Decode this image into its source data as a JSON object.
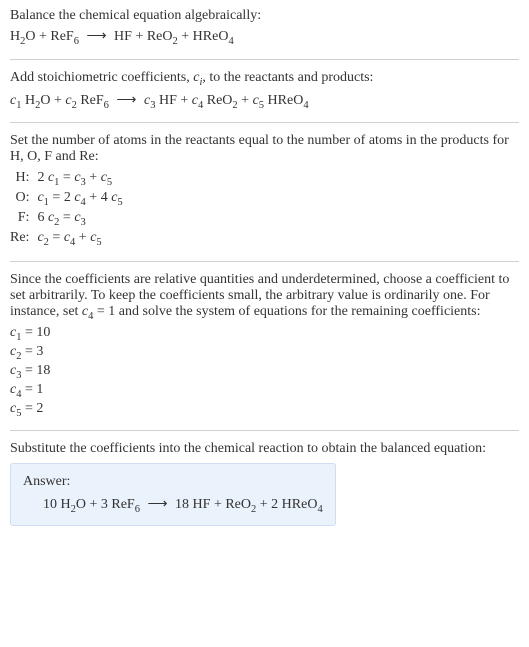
{
  "section1": {
    "title": "Balance the chemical equation algebraically:",
    "equation_parts": {
      "r1": "H",
      "r1_sub": "2",
      "r1_tail": "O + ReF",
      "r1_sub2": "6",
      "arrow": " ⟶ ",
      "p1": "HF + ReO",
      "p1_sub": "2",
      "p1_tail": " + HReO",
      "p1_sub2": "4"
    }
  },
  "section2": {
    "intro_a": "Add stoichiometric coefficients, ",
    "ci": "c",
    "ci_sub": "i",
    "intro_b": ", to the reactants and products:",
    "eq": {
      "c1": "c",
      "c1_sub": "1",
      "sp1": " H",
      "sp1_sub": "2",
      "sp1_tail": "O + ",
      "c2": "c",
      "c2_sub": "2",
      "sp2": " ReF",
      "sp2_sub": "6",
      "arrow": " ⟶ ",
      "c3": "c",
      "c3_sub": "3",
      "sp3": " HF + ",
      "c4": "c",
      "c4_sub": "4",
      "sp4": " ReO",
      "sp4_sub": "2",
      "sp4_tail": " + ",
      "c5": "c",
      "c5_sub": "5",
      "sp5": " HReO",
      "sp5_sub": "4"
    }
  },
  "section3": {
    "intro": "Set the number of atoms in the reactants equal to the number of atoms in the products for H, O, F and Re:",
    "rows": [
      {
        "elem": "H:",
        "lhs_a": "2 ",
        "lhs_c": "c",
        "lhs_sub": "1",
        "eq": " = ",
        "rhs_c1": "c",
        "rhs_sub1": "3",
        "plus": " + ",
        "rhs_c2": "c",
        "rhs_sub2": "5"
      },
      {
        "elem": "O:",
        "lhs_a": "",
        "lhs_c": "c",
        "lhs_sub": "1",
        "eq": " = 2 ",
        "rhs_c1": "c",
        "rhs_sub1": "4",
        "plus": " + 4 ",
        "rhs_c2": "c",
        "rhs_sub2": "5"
      },
      {
        "elem": "F:",
        "lhs_a": "6 ",
        "lhs_c": "c",
        "lhs_sub": "2",
        "eq": " = ",
        "rhs_c1": "c",
        "rhs_sub1": "3",
        "plus": "",
        "rhs_c2": "",
        "rhs_sub2": ""
      },
      {
        "elem": "Re:",
        "lhs_a": "",
        "lhs_c": "c",
        "lhs_sub": "2",
        "eq": " = ",
        "rhs_c1": "c",
        "rhs_sub1": "4",
        "plus": " + ",
        "rhs_c2": "c",
        "rhs_sub2": "5"
      }
    ]
  },
  "section4": {
    "intro_a": "Since the coefficients are relative quantities and underdetermined, choose a coefficient to set arbitrarily. To keep the coefficients small, the arbitrary value is ordinarily one. For instance, set ",
    "c4": "c",
    "c4_sub": "4",
    "intro_b": " = 1 and solve the system of equations for the remaining coefficients:",
    "coeffs": [
      {
        "c": "c",
        "sub": "1",
        "val": " = 10"
      },
      {
        "c": "c",
        "sub": "2",
        "val": " = 3"
      },
      {
        "c": "c",
        "sub": "3",
        "val": " = 18"
      },
      {
        "c": "c",
        "sub": "4",
        "val": " = 1"
      },
      {
        "c": "c",
        "sub": "5",
        "val": " = 2"
      }
    ]
  },
  "section5": {
    "intro": "Substitute the coefficients into the chemical reaction to obtain the balanced equation:",
    "answer_label": "Answer:",
    "eq": {
      "r1": "10 H",
      "r1_sub": "2",
      "r1_tail": "O + 3 ReF",
      "r1_sub2": "6",
      "arrow": " ⟶ ",
      "p1": "18 HF + ReO",
      "p1_sub": "2",
      "p1_tail": " + 2 HReO",
      "p1_sub2": "4"
    }
  }
}
